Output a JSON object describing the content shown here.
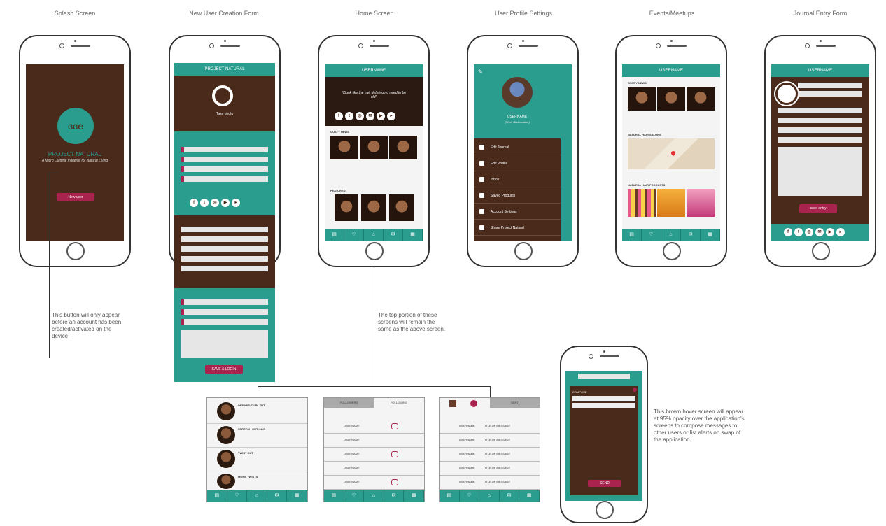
{
  "labels": {
    "splash": "Splash Screen",
    "new_user": "New User Creation Form",
    "home": "Home Screen",
    "profile": "User Profile Settings",
    "events": "Events/Meetups",
    "journal": "Journal Entry Form"
  },
  "splash": {
    "logo_text": "ɞɞe",
    "app_name": "PROJECT NATURAL",
    "tagline": "A Micro Cultural Initiative for Natural Living",
    "button": "New user"
  },
  "new_user": {
    "header": "PROJECT NATURAL",
    "photo_caption": "Take photo",
    "save_button": "SAVE & LOGIN"
  },
  "home": {
    "header": "USERNAME",
    "quote": "“Clunk like the hair defining no need to be old”",
    "section1": "GUSTY NEWS",
    "section2": "FEATURED"
  },
  "profile": {
    "username": "USERNAME",
    "subtitle": "(Short Bio/Location)",
    "menu": [
      "Edit Journal",
      "Edit Profile",
      "Inbox",
      "Saved Products",
      "Account Settings",
      "Share Project Natural"
    ]
  },
  "events": {
    "header": "USERNAME",
    "section1": "GUSTY NEWS",
    "section2": "NATURAL HAIR SALONS",
    "section3": "NATURAL HAIR PRODUCTS"
  },
  "journal": {
    "header": "USERNAME",
    "save": "save entry"
  },
  "panels": {
    "tab_followers": "FOLLOWERS",
    "tab_following": "FOLLOWING",
    "inbox_tab": "SENT",
    "username": "USERNAME",
    "msg_title": "TITLE OF MESSAGE",
    "list_titles": [
      "DEFINED CURL TUT",
      "STRETCH OUT HAIR",
      "TWIST OUT",
      "MORE TWISTS"
    ]
  },
  "compose": {
    "title": "COMPOSE",
    "send": "SEND"
  },
  "notes": {
    "button_note": "This button will only appear before an account has been created/activated on the device",
    "top_note": "The top portion of these screens will remain the same as the above screen.",
    "hover_note": "This brown hover screen will appear at 95% opacity over the application's screens to compose messages to other users or list alerts on swap of the application."
  },
  "colors": {
    "teal": "#2a9d8f",
    "brown": "#4a2a1a",
    "magenta": "#a8234d"
  }
}
